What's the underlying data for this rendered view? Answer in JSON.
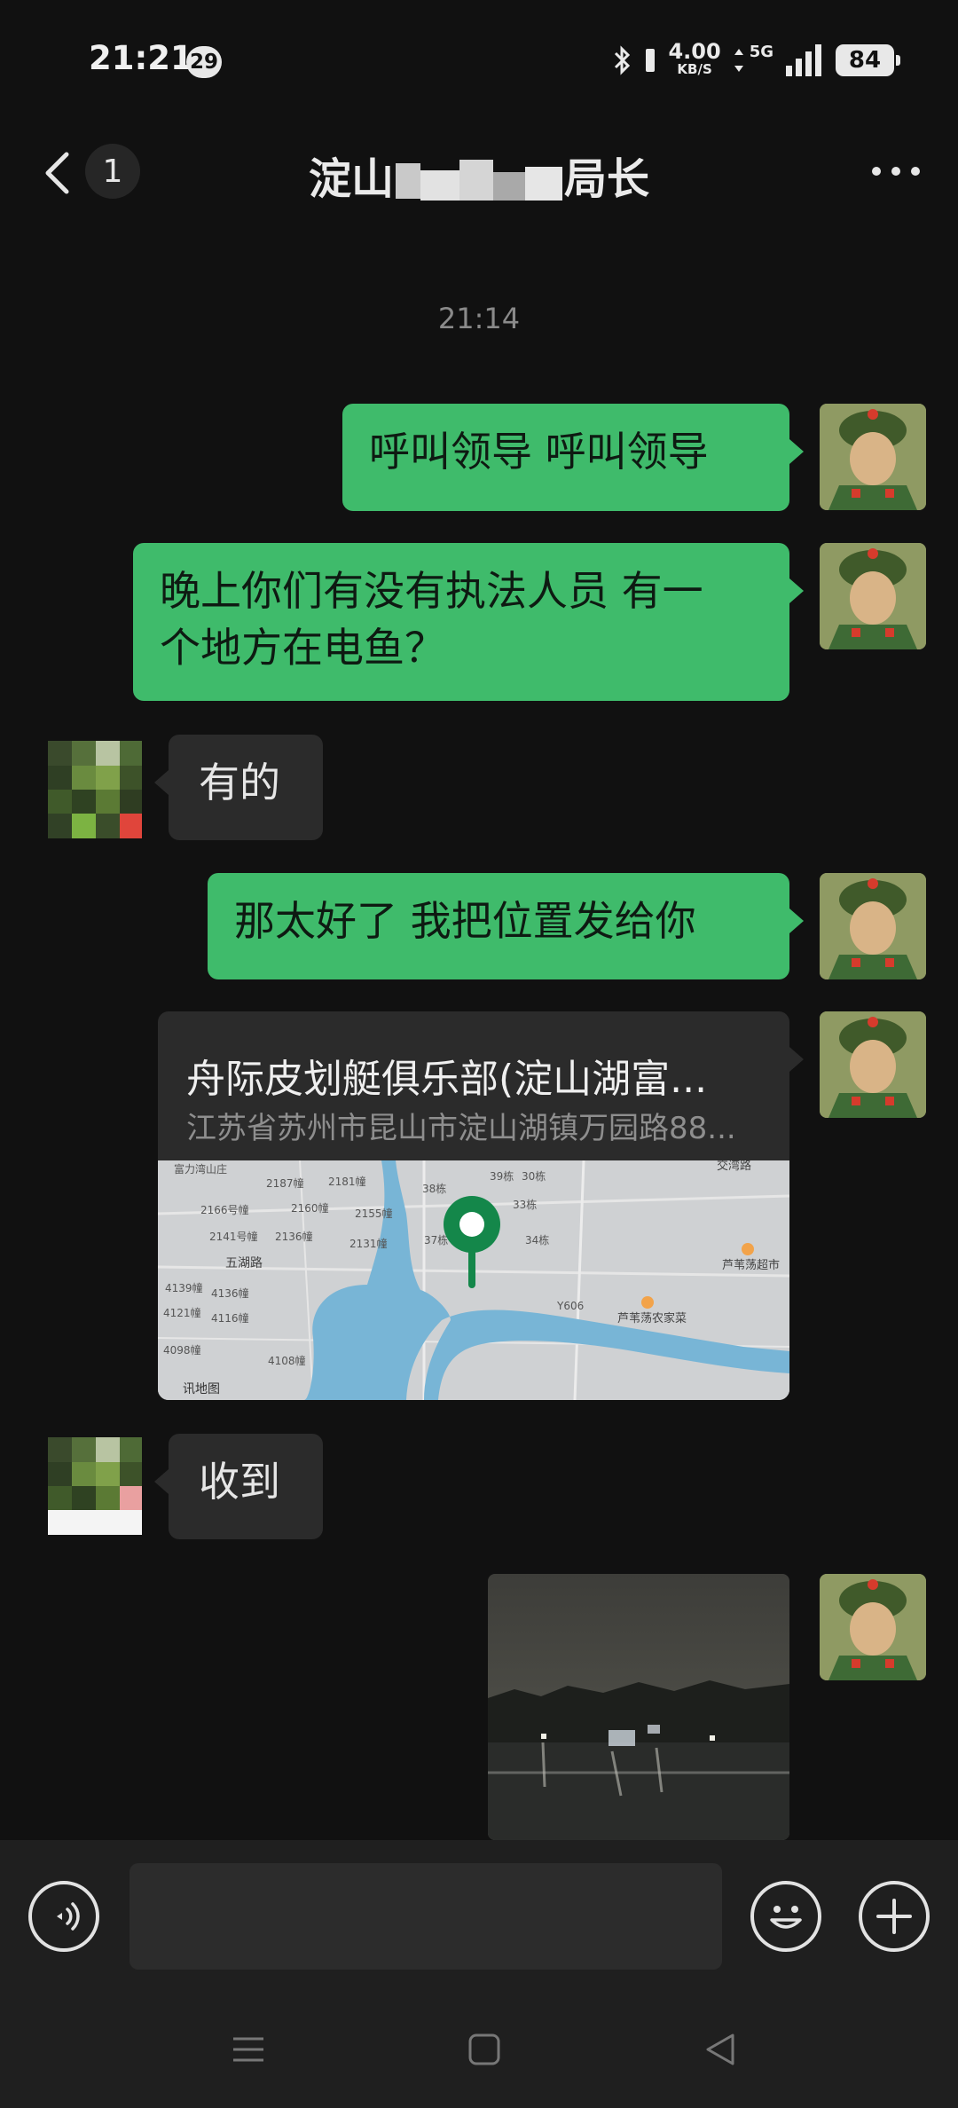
{
  "status_bar": {
    "time": "21:21",
    "notification_count": "29",
    "net_speed_value": "4.00",
    "net_speed_unit": "KB/S",
    "network_type": "5G",
    "battery": "84"
  },
  "header": {
    "unread_count": "1",
    "title_left": "淀山",
    "title_right": "局长"
  },
  "chat": {
    "timestamp": "21:14",
    "messages": [
      {
        "side": "me",
        "text": "呼叫领导 呼叫领导"
      },
      {
        "side": "me",
        "text_line1": "晚上你们有没有执法人员 有一",
        "text_line2": "个地方在电鱼？"
      },
      {
        "side": "them",
        "text": "有的"
      },
      {
        "side": "me",
        "text": "那太好了 我把位置发给你"
      },
      {
        "side": "me",
        "type": "location",
        "title": "舟际皮划艇俱乐部(淀山湖富...",
        "address": "江苏省苏州市昆山市淀山湖镇万园路88...",
        "map_labels": [
          "富力湾山庄",
          "2187幢",
          "2181幢",
          "2166号幢",
          "2160幢",
          "2155幢",
          "2141号幢",
          "2136幢",
          "2131幢",
          "五湖路",
          "4139幢",
          "4136幢",
          "4121幢",
          "4116幢",
          "4098幢",
          "4108幢",
          "讯地图",
          "39栋",
          "30栋",
          "38栋",
          "33栋",
          "37栋",
          "34栋",
          "Y606",
          "芦苇荡超市",
          "芦苇荡农家菜",
          "交湾路"
        ]
      },
      {
        "side": "them",
        "text": "收到"
      },
      {
        "side": "me",
        "type": "image"
      }
    ]
  },
  "input_bar": {
    "placeholder": ""
  },
  "colors": {
    "background": "#111111",
    "my_bubble": "#3fbb6b",
    "their_bubble": "#2b2b2b",
    "map_pin": "#14874a"
  }
}
